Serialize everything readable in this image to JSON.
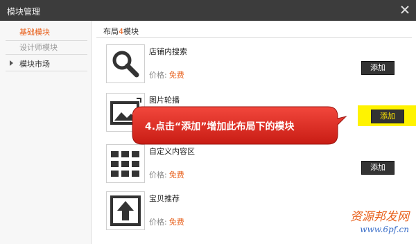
{
  "window": {
    "title": "模块管理",
    "close_icon": "close-icon"
  },
  "sidebar": {
    "items": [
      {
        "label": "基础模块",
        "state": "active"
      },
      {
        "label": "设计师模块",
        "state": "dim"
      },
      {
        "label": "模块市场",
        "state": "collapsed",
        "icon": "chevron-right-icon"
      }
    ]
  },
  "main": {
    "breadcrumb_prefix": "布局",
    "breadcrumb_accent": "4",
    "breadcrumb_suffix": "模块",
    "price_label": "价格:",
    "free_label": "免费",
    "add_label": "添加",
    "modules": [
      {
        "name": "店铺内搜索",
        "icon": "search-icon"
      },
      {
        "name": "图片轮播",
        "icon": "image-icon"
      },
      {
        "name": "自定义内容区",
        "icon": "grid-icon"
      },
      {
        "name": "宝贝推荐",
        "icon": "upload-arrow-icon"
      }
    ]
  },
  "callout": {
    "text": "4.点击“添加”增加此布局下的模块"
  },
  "watermark": {
    "main": "资源邦发网",
    "sub": "www.6pf.cn"
  },
  "colors": {
    "accent": "#e8601c",
    "highlight": "#fff300",
    "callout": "#e02a20",
    "titlebar": "#3c3c3c"
  }
}
